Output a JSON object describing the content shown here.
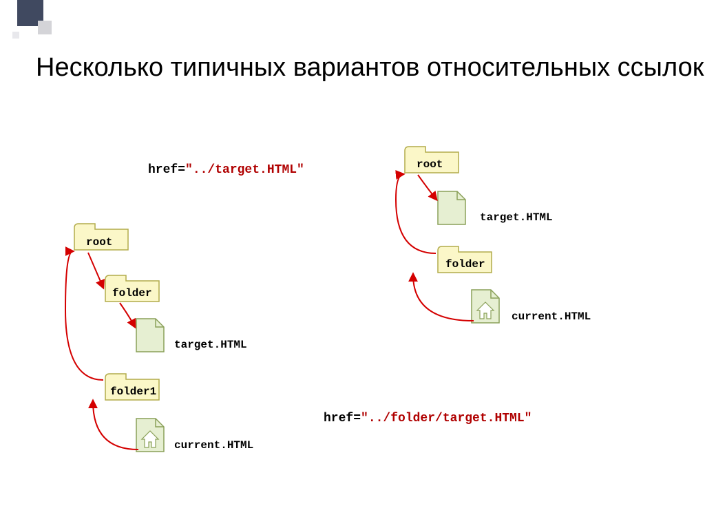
{
  "title": "Несколько типичных вариантов относительных ссылок",
  "chart_data": {
    "type": "diagram",
    "title": "Несколько типичных вариантов относительных ссылок",
    "xlabel": "",
    "ylabel": "",
    "examples": [
      {
        "href_prefix": "href=",
        "href_path": "\"../target.HTML\"",
        "tree": {
          "name": "root",
          "type": "folder",
          "children": [
            {
              "name": "folder",
              "type": "folder",
              "children": [
                {
                  "name": "target.HTML",
                  "type": "file"
                }
              ]
            },
            {
              "name": "folder1",
              "type": "folder",
              "children": [
                {
                  "name": "current.HTML",
                  "type": "file"
                }
              ]
            }
          ]
        },
        "current_file": "current.HTML",
        "target_file": "target.HTML",
        "path": [
          "folder1",
          "root",
          "folder"
        ]
      },
      {
        "href_prefix": "href=",
        "href_path": "\"../folder/target.HTML\"",
        "tree": {
          "name": "root",
          "type": "folder",
          "children": [
            {
              "name": "target.HTML",
              "type": "file"
            },
            {
              "name": "folder",
              "type": "folder",
              "children": [
                {
                  "name": "current.HTML",
                  "type": "file"
                }
              ]
            }
          ]
        },
        "current_file": "current.HTML",
        "target_file": "target.HTML",
        "path": [
          "folder",
          "root"
        ]
      }
    ]
  },
  "left": {
    "href_prefix": "href=",
    "href_path": "\"../target.HTML\"",
    "root": "root",
    "folder": "folder",
    "target": "target.HTML",
    "folder1": "folder1",
    "current": "current.HTML"
  },
  "right": {
    "href_prefix": "href=",
    "href_path": "\"../folder/target.HTML\"",
    "root": "root",
    "target": "target.HTML",
    "folder": "folder",
    "current": "current.HTML"
  }
}
